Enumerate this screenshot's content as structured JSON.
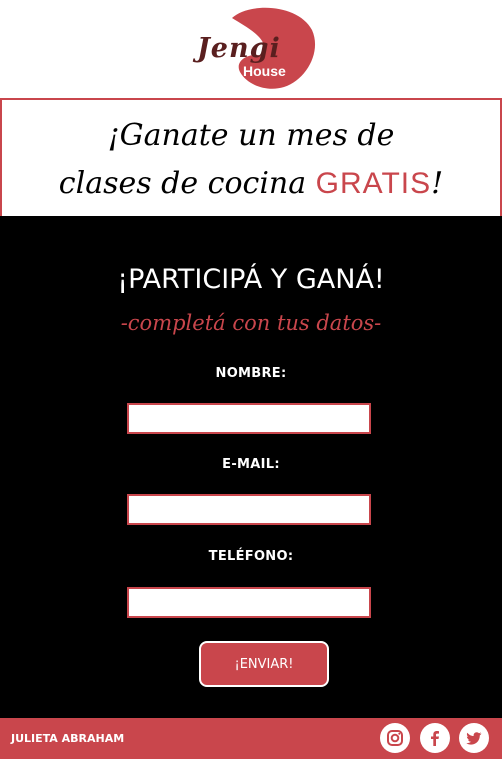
{
  "brand": {
    "logo_name": "Jengi",
    "logo_sub": "House",
    "accent_color": "#c9464c"
  },
  "banner": {
    "line1": "¡Ganate un mes de",
    "line2_prefix": "clases de cocina ",
    "line2_highlight": "GRATIS",
    "line2_suffix": "!"
  },
  "form": {
    "title": "¡PARTICIPÁ Y GANÁ!",
    "subtitle": "-completá con tus datos-",
    "fields": [
      {
        "label": "NOMBRE:",
        "value": "",
        "placeholder": ""
      },
      {
        "label": "E-MAIL:",
        "value": "",
        "placeholder": ""
      },
      {
        "label": "TELÉFONO:",
        "value": "",
        "placeholder": ""
      }
    ],
    "submit_label": "¡ENVIAR!"
  },
  "footer": {
    "author": "JULIETA ABRAHAM",
    "social_icons": [
      "instagram-icon",
      "facebook-icon",
      "twitter-icon"
    ]
  }
}
